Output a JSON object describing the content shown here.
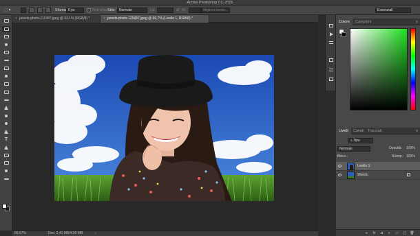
{
  "window": {
    "title": "Adobe Photoshop CC 2015"
  },
  "options_bar": {
    "feather_label": "Sfuma:",
    "feather_value": "0 px",
    "antialias_label": "Anti-alias",
    "style_label": "Stile:",
    "style_value": "Normale",
    "width_label": "La:",
    "height_label": "Al:",
    "refine_edge_label": "Migliora bordo...",
    "workspace_value": "Essenziali"
  },
  "tabs": [
    {
      "label": "pexels-photo-211997.jpeg @ 93,1% (RGB/8) *"
    },
    {
      "label": "pexels-photo-125457.jpeg @ 66,7% (Livello 1, RGB/8) *"
    }
  ],
  "tools": [
    {
      "name": "move-tool-icon"
    },
    {
      "name": "marquee-tool-icon"
    },
    {
      "name": "lasso-tool-icon"
    },
    {
      "name": "quick-select-tool-icon"
    },
    {
      "name": "crop-tool-icon"
    },
    {
      "name": "eyedropper-tool-icon"
    },
    {
      "name": "healing-brush-tool-icon"
    },
    {
      "name": "brush-tool-icon"
    },
    {
      "name": "clone-stamp-tool-icon"
    },
    {
      "name": "history-brush-tool-icon"
    },
    {
      "name": "eraser-tool-icon"
    },
    {
      "name": "paint-bucket-tool-icon"
    },
    {
      "name": "blur-tool-icon"
    },
    {
      "name": "dodge-tool-icon"
    },
    {
      "name": "pen-tool-icon"
    },
    {
      "name": "type-tool-icon"
    },
    {
      "name": "path-select-tool-icon"
    },
    {
      "name": "rectangle-tool-icon"
    },
    {
      "name": "hand-tool-icon"
    },
    {
      "name": "zoom-tool-icon"
    },
    {
      "name": "more-tools-icon"
    }
  ],
  "type_tool_glyph": "T",
  "status": {
    "zoom": "66,67%",
    "doc": "Doc: 2,41 MB/4,50 MB",
    "arrow": "›"
  },
  "color_panel": {
    "tab_color": "Colore",
    "tab_swatches": "Campioni"
  },
  "layers_panel": {
    "tab_layers": "Livelli",
    "tab_channels": "Canali",
    "tab_paths": "Tracciati",
    "filter_label": "Tipo",
    "blend_mode": "Normale",
    "opacity_label": "Opacità:",
    "opacity_value": "100%",
    "lock_label": "Blocc.:",
    "fill_label": "Riemp.:",
    "fill_value": "100%",
    "layers": [
      {
        "name": "Livello 1",
        "active": true
      },
      {
        "name": "Sfondo",
        "active": false
      }
    ],
    "footer_icons": [
      "link-layers-icon",
      "fx-icon",
      "layer-mask-icon",
      "adjustment-layer-icon",
      "group-icon",
      "new-layer-icon",
      "delete-layer-icon"
    ],
    "footer_labels": [
      "∞",
      "fx",
      "◘",
      "◐",
      "▭",
      "▢",
      "🗑"
    ]
  },
  "colors": {
    "sky": "#2a5fc4",
    "grass": "#3a7a1e",
    "picker_hue": "#1ee01e"
  }
}
